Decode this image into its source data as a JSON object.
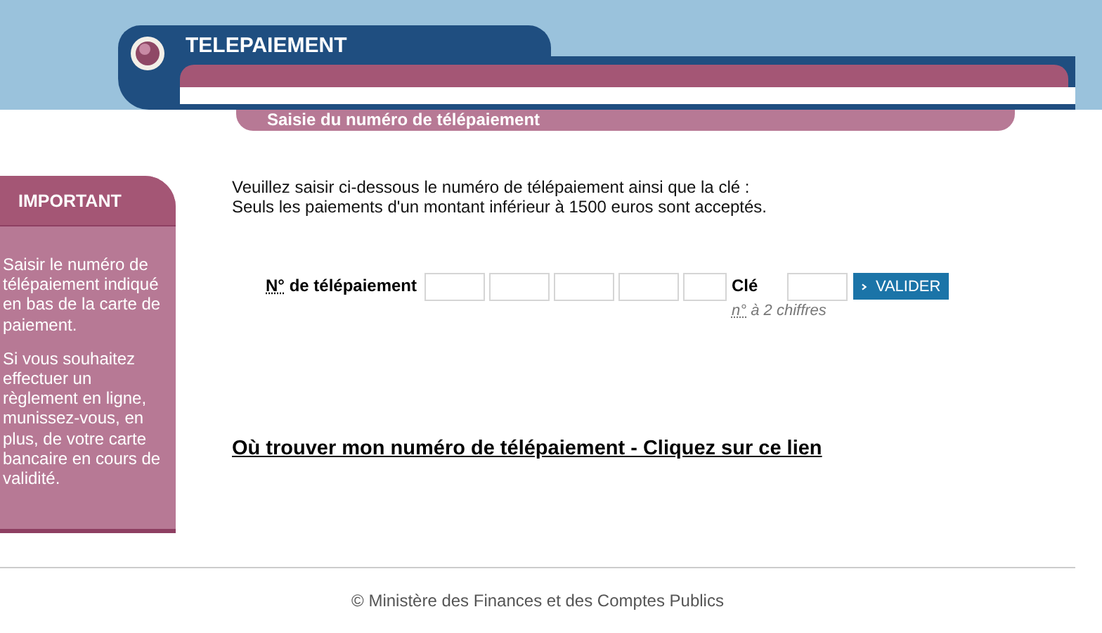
{
  "header": {
    "title": "TELEPAIEMENT",
    "subtitle": "Saisie du numéro de télépaiement"
  },
  "sidebar": {
    "title": "IMPORTANT",
    "paragraphs": [
      "Saisir le numéro de télépaiement indiqué en bas de la carte de paiement.",
      "Si vous souhaitez effectuer un règlement en ligne, munissez-vous, en plus, de votre carte bancaire en cours de validité."
    ]
  },
  "intro": [
    "Veuillez saisir ci-dessous le numéro de télépaiement ainsi que la clé :",
    "Seuls les paiements d'un montant inférieur à 1500 euros sont acceptés."
  ],
  "form": {
    "number_label_abbr": "N°",
    "number_label_rest": "de télépaiement",
    "number_fields": [
      {
        "kind": "wide"
      },
      {
        "kind": "wide"
      },
      {
        "kind": "wide"
      },
      {
        "kind": "wide"
      },
      {
        "kind": "narrow"
      }
    ],
    "key_label": "Clé",
    "key_hint_abbr": "n°",
    "key_hint_rest": "à 2 chiffres",
    "submit": "VALIDER"
  },
  "help_link": "Où trouver mon numéro de télépaiement - Cliquez sur ce lien",
  "footer": "© Ministère des Finances et des Comptes Publics"
}
